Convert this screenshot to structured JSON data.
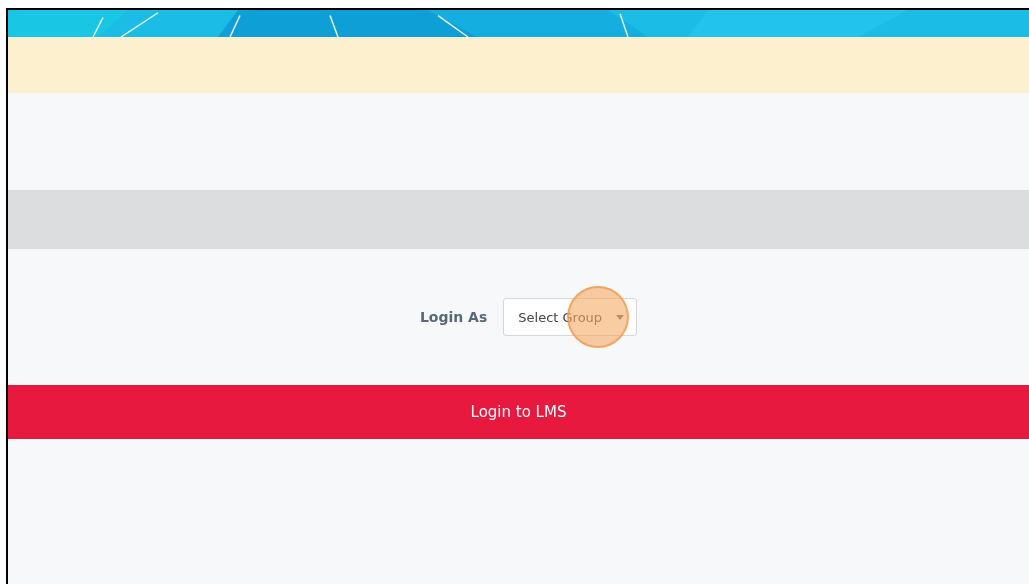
{
  "login_form": {
    "label": "Login As",
    "group_select": {
      "value": "Select Group"
    }
  },
  "login_button": {
    "label": "Login to LMS"
  }
}
